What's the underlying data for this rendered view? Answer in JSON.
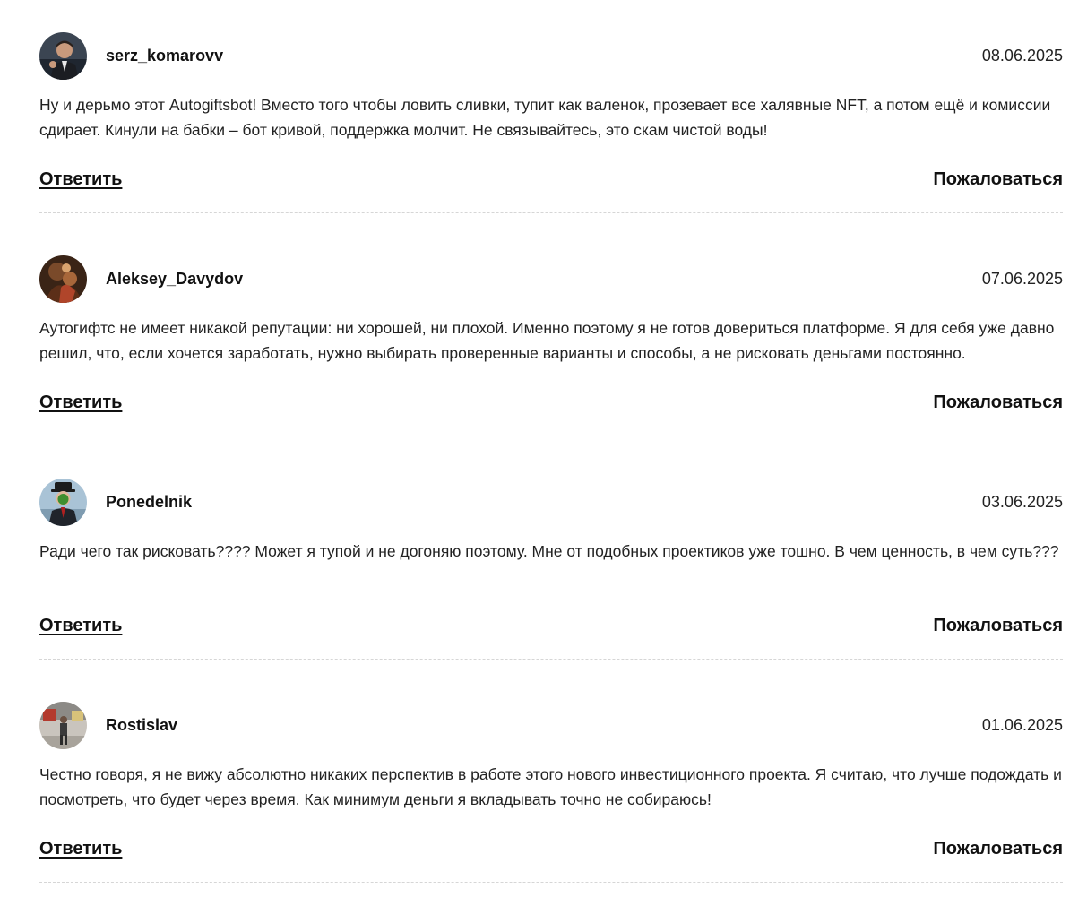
{
  "comments": [
    {
      "author": "serz_komarovv",
      "date": "08.06.2025",
      "text": "Ну и дерьмо этот Autogiftsbot! Вместо того чтобы ловить сливки, тупит как валенок, прозевает все халявные NFT, а потом ещё и комиссии сдирает. Кинули на бабки – бот кривой, поддержка молчит. Не связывайтесь, это скам чистой воды!",
      "reply_label": "Ответить",
      "report_label": "Пожаловаться"
    },
    {
      "author": "Aleksey_Davydov",
      "date": "07.06.2025",
      "text": "Аутогифтс не имеет никакой репутации: ни хорошей, ни плохой. Именно поэтому я не готов довериться платформе. Я для себя уже давно решил, что, если хочется заработать, нужно выбирать проверенные варианты и способы, а не рисковать деньгами постоянно.",
      "reply_label": "Ответить",
      "report_label": "Пожаловаться"
    },
    {
      "author": "Ponedelnik",
      "date": "03.06.2025",
      "text": "Ради чего так рисковать???? Может я тупой и не догоняю поэтому. Мне от подобных проектиков уже тошно. В чем ценность, в чем суть???",
      "reply_label": "Ответить",
      "report_label": "Пожаловаться"
    },
    {
      "author": "Rostislav",
      "date": "01.06.2025",
      "text": "Честно говоря, я не вижу абсолютно никаких перспектив в работе этого нового инвестиционного проекта. Я считаю, что лучше подождать и посмотреть, что будет через время. Как минимум деньги я вкладывать точно не собираюсь!",
      "reply_label": "Ответить",
      "report_label": "Пожаловаться"
    }
  ]
}
